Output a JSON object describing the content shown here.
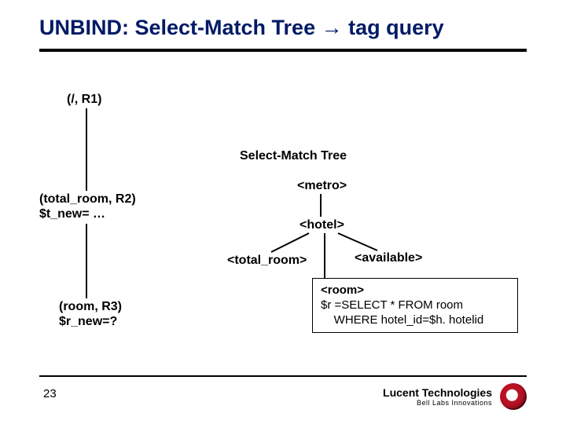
{
  "title": {
    "pre": "UNBIND: Select-Match Tree ",
    "arrow": "→",
    "post": " tag query"
  },
  "left_tree": {
    "n1": "(/, R1)",
    "n2_l1": "(total_room, R2)",
    "n2_l2": "$t_new= …",
    "n3_l1": "(room, R3)",
    "n3_l2": "$r_new=?"
  },
  "right_tree": {
    "title": "Select-Match Tree",
    "metro": "<metro>",
    "hotel": "<hotel>",
    "total_room": "<total_room>",
    "available": "<available>",
    "room_l1": "<room>",
    "room_l2": "$r =SELECT * FROM room",
    "room_l3": "    WHERE hotel_id=$h. hotelid"
  },
  "footer": {
    "page": "23",
    "logo_l1": "Lucent Technologies",
    "logo_l2": "Bell Labs Innovations"
  }
}
